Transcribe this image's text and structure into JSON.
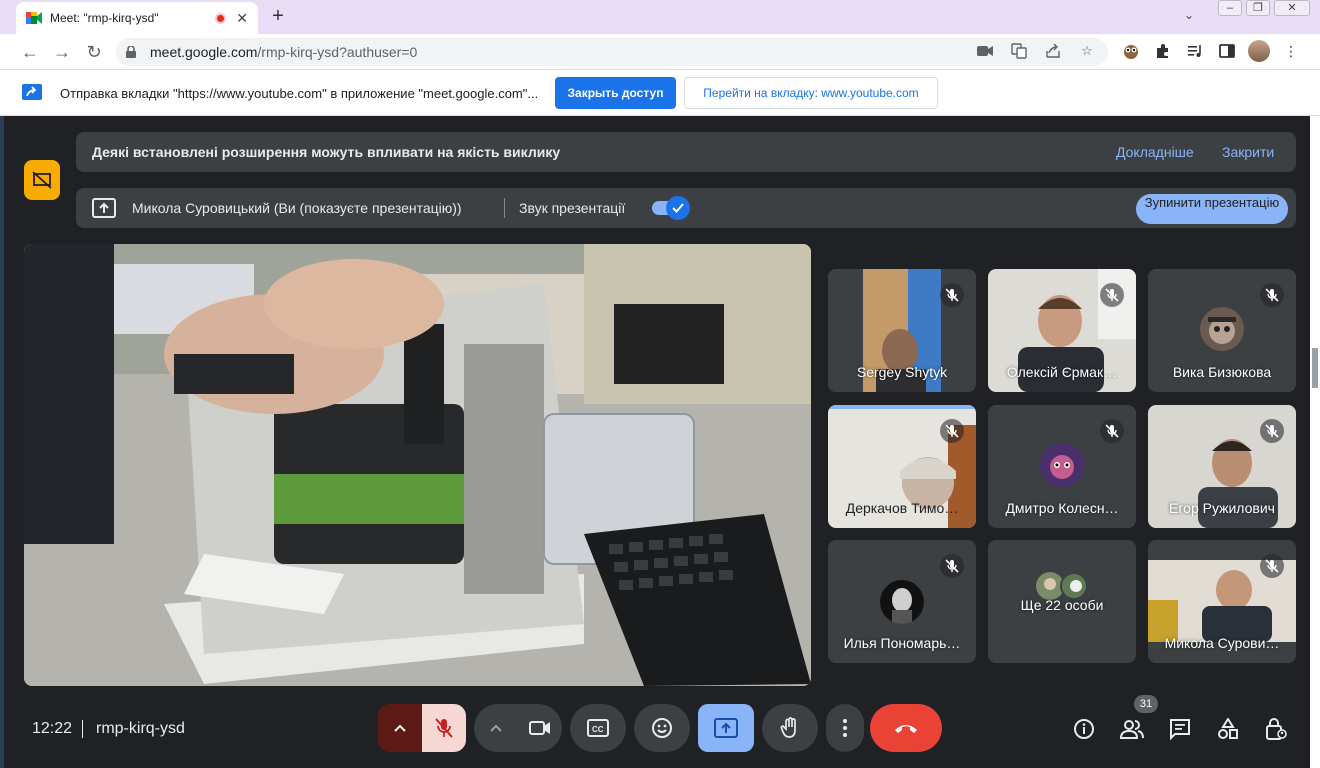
{
  "browser": {
    "tab_title": "Meet: \"rmp-kirq-ysd\"",
    "url_host": "meet.google.com",
    "url_path": "/rmp-kirq-ysd?authuser=0"
  },
  "cast_bar": {
    "message": "Отправка вкладки \"https://www.youtube.com\" в приложение \"meet.google.com\"...",
    "stop_label": "Закрыть доступ",
    "goto_label": "Перейти на вкладку: www.youtube.com"
  },
  "notice": {
    "text": "Деякі встановлені розширення можуть впливати на якість виклику",
    "more": "Докладніше",
    "close": "Закрити"
  },
  "presenting": {
    "text": "Микола Суровицький (Ви (показуєте презентацію))",
    "sound_label": "Звук презентації",
    "sound_on": true,
    "stop_label": "Зупинити презентацію"
  },
  "participants": [
    {
      "name": "Sergey Shytyk",
      "muted": true
    },
    {
      "name": "Олексій Єрмак…",
      "muted": true
    },
    {
      "name": "Вика Бизюкова",
      "muted": true
    },
    {
      "name": "Деркачов Тимо…",
      "muted": true
    },
    {
      "name": "Дмитро Колесн…",
      "muted": true
    },
    {
      "name": "Егор Ружилович",
      "muted": true
    },
    {
      "name": "Илья Пономарь…",
      "muted": true
    },
    {
      "name": "Ще 22 особи"
    },
    {
      "name": "Микола Сурови…",
      "muted": true
    }
  ],
  "footer": {
    "time": "12:22",
    "meeting_code": "rmp-kirq-ysd",
    "people_count": "31"
  },
  "colors": {
    "accent": "#8ab4f8",
    "danger": "#ea4335",
    "warning": "#f9ab00"
  }
}
